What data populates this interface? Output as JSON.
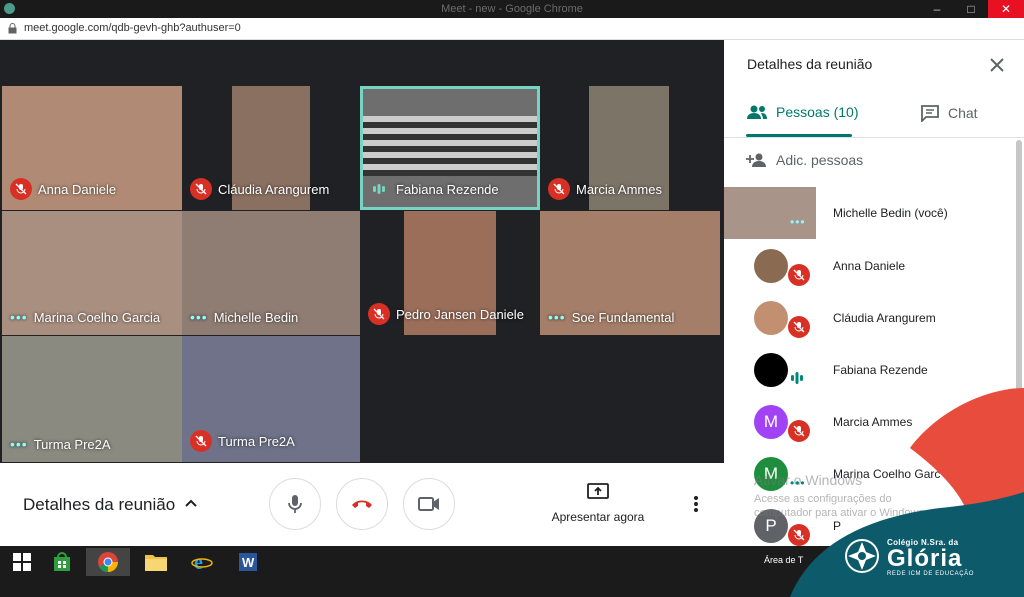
{
  "window": {
    "title": "Meet - new - Google Chrome",
    "url": "meet.google.com/qdb-gevh-ghb?authuser=0"
  },
  "tiles": [
    {
      "name": "Anna Daniele",
      "status": "muted",
      "bg": "#b08a74"
    },
    {
      "name": "Cláudia Arangurem",
      "status": "muted",
      "bg": "#8a7060"
    },
    {
      "name": "Fabiana Rezende",
      "status": "speaking",
      "bg": "#6e6e6e"
    },
    {
      "name": "Marcia Ammes",
      "status": "muted",
      "bg": "#7d7468"
    },
    {
      "name": "Marina Coelho Garcia",
      "status": "active",
      "bg": "#a88f80"
    },
    {
      "name": "Michelle Bedin",
      "status": "active",
      "bg": "#8f7c73"
    },
    {
      "name": "Pedro Jansen Daniele",
      "status": "muted",
      "bg": "#9b6e5a"
    },
    {
      "name": "Soe Fundamental",
      "status": "active",
      "bg": "#a47e68"
    },
    {
      "name": "Turma Pre2A",
      "status": "active",
      "bg": "#8a8a80"
    },
    {
      "name": "Turma Pre2A",
      "status": "muted",
      "bg": "#6f7288"
    }
  ],
  "bottombar": {
    "details_label": "Detalhes da reunião",
    "present_label": "Apresentar agora"
  },
  "panel": {
    "title": "Detalhes da reunião",
    "tab_people": "Pessoas (10)",
    "tab_chat": "Chat",
    "add_people": "Adic. pessoas",
    "people": [
      {
        "name": "Michelle Bedin (você)",
        "status": "active"
      },
      {
        "name": "Anna Daniele",
        "status": "muted",
        "avatar_color": "#8a6a50"
      },
      {
        "name": "Cláudia Arangurem",
        "status": "muted",
        "avatar_color": "#c29070"
      },
      {
        "name": "Fabiana Rezende",
        "status": "speaking",
        "avatar_color": "#000000"
      },
      {
        "name": "Marcia Ammes",
        "status": "muted",
        "initial": "M",
        "avatar_color": "#a142f4"
      },
      {
        "name": "Marina Coelho Garc",
        "status": "active",
        "initial": "M",
        "avatar_color": "#1e8e3e"
      },
      {
        "name": "P",
        "status": "muted",
        "initial": "P",
        "avatar_color": "#5f6368"
      }
    ],
    "watermark_title": "Ativar o Windows",
    "watermark_body": "Acesse as configurações do computador para ativar o Windows."
  },
  "taskbar": {
    "area_label": "Área de T"
  },
  "brand": {
    "small": "Colégio N.Sra. da",
    "big": "Glória",
    "sub": "REDE ICM DE EDUCAÇÃO"
  },
  "colors": {
    "accent": "#00796b",
    "muted_red": "#d93025",
    "active_border": "#75d5c2",
    "brand_teal": "#0d5a6a",
    "brand_red": "#e84c3d"
  }
}
